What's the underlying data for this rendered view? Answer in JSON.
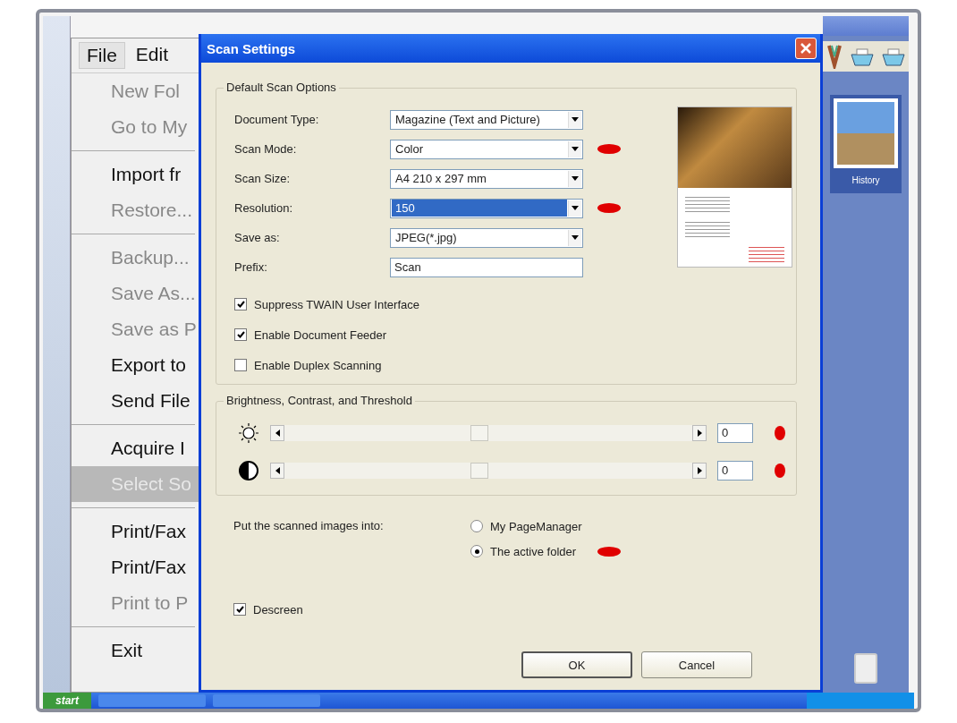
{
  "menu_bar": [
    {
      "label": "File",
      "selected": true
    },
    {
      "label": "Edit",
      "selected": false
    }
  ],
  "file_menu": [
    {
      "kind": "item",
      "label": "New Fol",
      "disabled": true,
      "selected": false
    },
    {
      "kind": "item",
      "label": "Go to My",
      "disabled": true,
      "selected": false
    },
    {
      "kind": "separator"
    },
    {
      "kind": "item",
      "label": "Import fr",
      "disabled": false,
      "selected": false
    },
    {
      "kind": "item",
      "label": "Restore...",
      "disabled": true,
      "selected": false
    },
    {
      "kind": "separator"
    },
    {
      "kind": "item",
      "label": "Backup...",
      "disabled": true,
      "selected": false
    },
    {
      "kind": "item",
      "label": "Save As...",
      "disabled": true,
      "selected": false
    },
    {
      "kind": "item",
      "label": "Save as P",
      "disabled": true,
      "selected": false
    },
    {
      "kind": "item",
      "label": "Export to",
      "disabled": false,
      "selected": false
    },
    {
      "kind": "item",
      "label": "Send File",
      "disabled": false,
      "selected": false
    },
    {
      "kind": "separator"
    },
    {
      "kind": "item",
      "label": "Acquire I",
      "disabled": false,
      "selected": false
    },
    {
      "kind": "item",
      "label": "Select So",
      "disabled": false,
      "selected": true
    },
    {
      "kind": "separator"
    },
    {
      "kind": "item",
      "label": "Print/Fax",
      "disabled": false,
      "selected": false
    },
    {
      "kind": "item",
      "label": "Print/Fax",
      "disabled": false,
      "selected": false
    },
    {
      "kind": "item",
      "label": "Print to P",
      "disabled": true,
      "selected": false
    },
    {
      "kind": "separator"
    },
    {
      "kind": "item",
      "label": "Exit",
      "disabled": false,
      "selected": false
    }
  ],
  "dialog": {
    "title": "Scan Settings",
    "default_options": {
      "title": "Default Scan Options",
      "fields": [
        {
          "kind": "dropdown",
          "label": "Document Type:",
          "value": "Magazine (Text and Picture)",
          "selected": false,
          "annotated": false
        },
        {
          "kind": "dropdown",
          "label": "Scan Mode:",
          "value": "Color",
          "selected": false,
          "annotated": true
        },
        {
          "kind": "dropdown",
          "label": "Scan Size:",
          "value": "A4 210 x 297 mm",
          "selected": false,
          "annotated": false
        },
        {
          "kind": "dropdown",
          "label": "Resolution:",
          "value": "150",
          "selected": true,
          "annotated": true
        },
        {
          "kind": "dropdown",
          "label": "Save as:",
          "value": "JPEG(*.jpg)",
          "selected": false,
          "annotated": false
        },
        {
          "kind": "text",
          "label": "Prefix:",
          "value": "Scan",
          "selected": false,
          "annotated": false
        }
      ],
      "checkboxes": [
        {
          "label": "Suppress TWAIN User Interface",
          "checked": true
        },
        {
          "label": "Enable Document Feeder",
          "checked": true
        },
        {
          "label": "Enable Duplex Scanning",
          "checked": false
        }
      ]
    },
    "adjustments": {
      "title": "Brightness, Contrast, and Threshold",
      "sliders": [
        {
          "kind": "brightness",
          "level": 0.5,
          "value": "0",
          "annotated": true
        },
        {
          "kind": "contrast",
          "level": 0.5,
          "value": "0",
          "annotated": true
        }
      ]
    },
    "destination": {
      "label": "Put the scanned images into:",
      "options": [
        {
          "label": "My PageManager",
          "selected": false,
          "annotated": false
        },
        {
          "label": "The active folder",
          "selected": true,
          "annotated": true
        }
      ]
    },
    "descreen": {
      "label": "Descreen",
      "checked": true
    },
    "buttons": [
      {
        "label": "OK",
        "default": true
      },
      {
        "label": "Cancel",
        "default": false
      }
    ]
  },
  "side_panel": {
    "thumbnail_label": "History"
  },
  "taskbar": {
    "start": "start"
  }
}
